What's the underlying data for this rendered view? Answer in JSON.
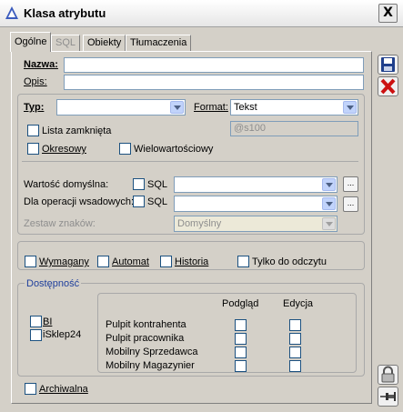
{
  "window": {
    "title": "Klasa atrybutu",
    "close_label": "X"
  },
  "tabs": [
    {
      "label": "Ogólne",
      "active": true
    },
    {
      "label": "SQL",
      "enabled": false
    },
    {
      "label": "Obiekty"
    },
    {
      "label": "Tłumaczenia"
    }
  ],
  "form": {
    "name_label": "Nazwa:",
    "name_value": "",
    "desc_label": "Opis:",
    "desc_value": "",
    "type_label": "Typ:",
    "type_value": "",
    "format_label": "Format:",
    "format_value": "Tekst",
    "closed_list_label": "Lista zamknięta",
    "format_mask_placeholder": "@s100",
    "periodic_label": "Okresowy",
    "multivalue_label": "Wielowartościowy",
    "default_value_label": "Wartość domyślna:",
    "default_sql_label": "SQL",
    "batch_ops_label": "Dla operacji wsadowych:",
    "batch_sql_label": "SQL",
    "charset_label": "Zestaw znaków:",
    "charset_value": "Domyślny",
    "required_label": "Wymagany",
    "auto_label": "Automat",
    "history_label": "Historia",
    "readonly_label": "Tylko do odczytu",
    "availability_label": "Dostępność",
    "bi_label": "BI",
    "isklep_label": "iSklep24",
    "col_preview": "Podgląd",
    "col_edit": "Edycja",
    "rows": [
      "Pulpit kontrahenta",
      "Pulpit pracownika",
      "Mobilny Sprzedawca",
      "Mobilny Magazynier"
    ],
    "archived_label": "Archiwalna",
    "ellipsis": "..."
  },
  "colors": {
    "save": "#1f3f8c",
    "cancel": "#cc1111"
  }
}
